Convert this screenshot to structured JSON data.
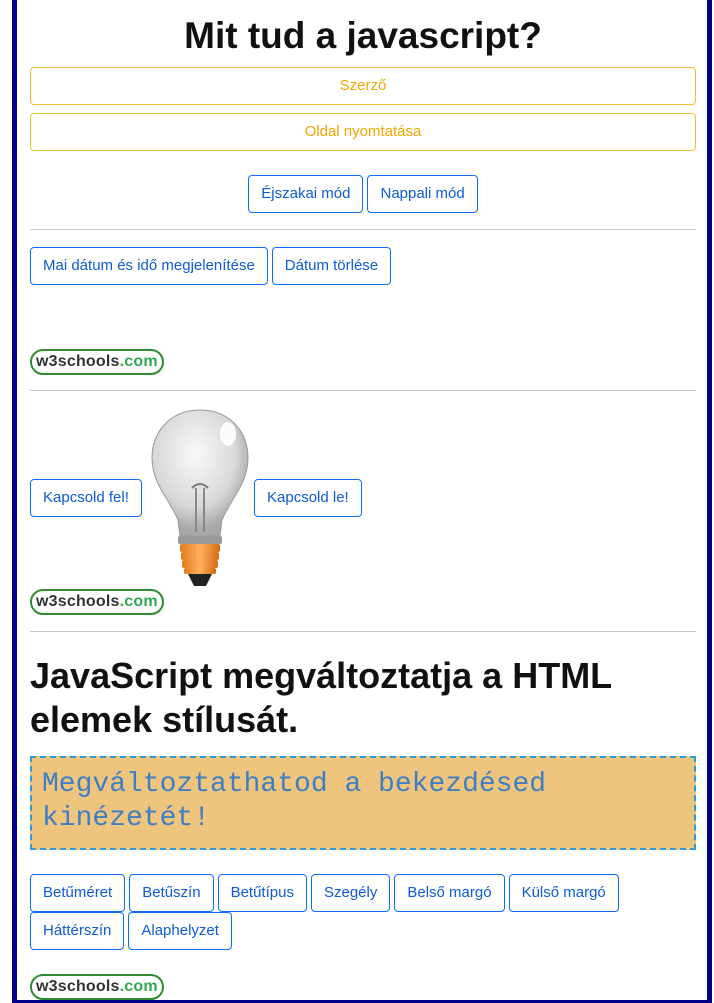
{
  "page": {
    "title": "Mit tud a javascript?"
  },
  "author_button": {
    "label": "Szerző"
  },
  "print_button": {
    "label": "Oldal nyomtatása"
  },
  "mode_buttons": {
    "night": "Éjszakai mód",
    "day": "Nappali mód"
  },
  "date_buttons": {
    "show": "Mai dátum és idő megjelenítése",
    "clear": "Dátum törlése"
  },
  "logo": {
    "part1": "w3schools",
    "part2": ".com"
  },
  "bulb_section": {
    "on": "Kapcsold fel!",
    "off": "Kapcsold le!"
  },
  "style_section": {
    "title": "JavaScript megváltoztatja a HTML elemek stílusát.",
    "paragraph": "Megváltoztathatod a bekezdésed kinézetét!",
    "buttons": [
      "Betűméret",
      "Betűszín",
      "Betűtípus",
      "Szegély",
      "Belső margó",
      "Külső margó",
      "Háttérszín",
      "Alaphelyzet"
    ]
  },
  "colors": {
    "frame": "#00008b",
    "primary": "#0d6efd",
    "warning": "#f0c030",
    "demo_bg": "#efc47d",
    "demo_border": "#2d9cdb",
    "demo_text": "#3d7fc4"
  }
}
